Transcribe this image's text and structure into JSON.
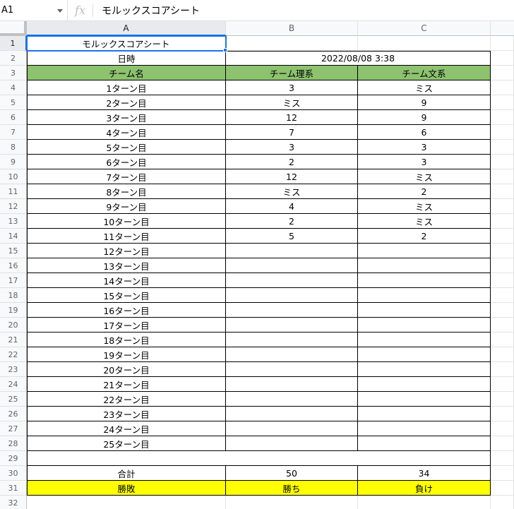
{
  "formula_bar": {
    "name_box": "A1",
    "fx": "fx",
    "content": "モルックスコアシート"
  },
  "columns": [
    "A",
    "B",
    "C"
  ],
  "rows": [
    "1",
    "2",
    "3",
    "4",
    "5",
    "6",
    "7",
    "8",
    "9",
    "10",
    "11",
    "12",
    "13",
    "14",
    "15",
    "16",
    "17",
    "18",
    "19",
    "20",
    "21",
    "22",
    "23",
    "24",
    "25",
    "26",
    "27",
    "28",
    "29",
    "30",
    "31",
    "32"
  ],
  "sheet": {
    "title": "モルックスコアシート",
    "datetime_label": "日時",
    "datetime_value": "2022/08/08 3:38",
    "header": {
      "team_label": "チーム名",
      "team_b": "チーム理系",
      "team_c": "チーム文系"
    },
    "turns": [
      {
        "label": "1ターン目",
        "b": "3",
        "c": "ミス"
      },
      {
        "label": "2ターン目",
        "b": "ミス",
        "c": "9"
      },
      {
        "label": "3ターン目",
        "b": "12",
        "c": "9"
      },
      {
        "label": "4ターン目",
        "b": "7",
        "c": "6"
      },
      {
        "label": "5ターン目",
        "b": "3",
        "c": "3"
      },
      {
        "label": "6ターン目",
        "b": "2",
        "c": "3"
      },
      {
        "label": "7ターン目",
        "b": "12",
        "c": "ミス"
      },
      {
        "label": "8ターン目",
        "b": "ミス",
        "c": "2"
      },
      {
        "label": "9ターン目",
        "b": "4",
        "c": "ミス"
      },
      {
        "label": "10ターン目",
        "b": "2",
        "c": "ミス"
      },
      {
        "label": "11ターン目",
        "b": "5",
        "c": "2"
      },
      {
        "label": "12ターン目",
        "b": "",
        "c": ""
      },
      {
        "label": "13ターン目",
        "b": "",
        "c": ""
      },
      {
        "label": "14ターン目",
        "b": "",
        "c": ""
      },
      {
        "label": "15ターン目",
        "b": "",
        "c": ""
      },
      {
        "label": "16ターン目",
        "b": "",
        "c": ""
      },
      {
        "label": "17ターン目",
        "b": "",
        "c": ""
      },
      {
        "label": "18ターン目",
        "b": "",
        "c": ""
      },
      {
        "label": "19ターン目",
        "b": "",
        "c": ""
      },
      {
        "label": "20ターン目",
        "b": "",
        "c": ""
      },
      {
        "label": "21ターン目",
        "b": "",
        "c": ""
      },
      {
        "label": "22ターン目",
        "b": "",
        "c": ""
      },
      {
        "label": "23ターン目",
        "b": "",
        "c": ""
      },
      {
        "label": "24ターン目",
        "b": "",
        "c": ""
      },
      {
        "label": "25ターン目",
        "b": "",
        "c": ""
      }
    ],
    "total": {
      "label": "合計",
      "b": "50",
      "c": "34"
    },
    "result": {
      "label": "勝敗",
      "b": "勝ち",
      "c": "負け"
    }
  },
  "colors": {
    "header_green": "#8dc26f",
    "result_yellow": "#ffff00",
    "selection_blue": "#1a73e8"
  }
}
